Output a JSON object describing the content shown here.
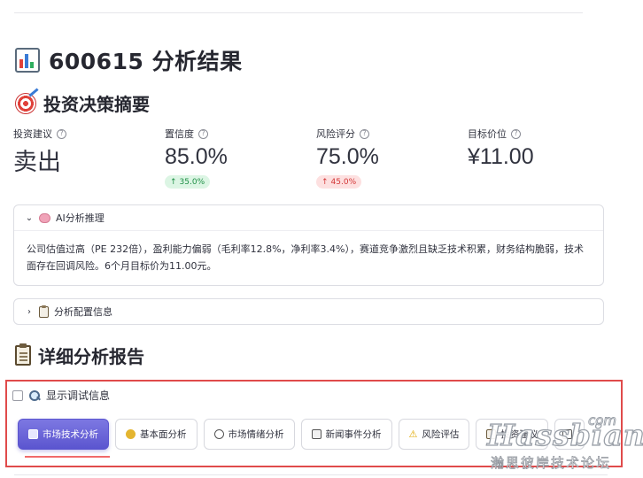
{
  "result_heading": {
    "text": "600615 分析结果",
    "icon": "bar-chart-icon"
  },
  "summary_heading": {
    "text": "投资决策摘要",
    "icon": "target-icon"
  },
  "metrics": [
    {
      "label": "投资建议",
      "value": "卖出",
      "delta": ""
    },
    {
      "label": "置信度",
      "value": "85.0%",
      "delta": "35.0%",
      "delta_direction": "up"
    },
    {
      "label": "风险评分",
      "value": "75.0%",
      "delta": "45.0%",
      "delta_direction": "up"
    },
    {
      "label": "目标价位",
      "value": "¥11.00",
      "delta": ""
    }
  ],
  "ai_reasoning": {
    "title": "AI分析推理",
    "expanded": true,
    "body": "公司估值过高（PE 232倍），盈利能力偏弱（毛利率12.8%，净利率3.4%），赛道竞争激烈且缺乏技术积累，财务结构脆弱，技术面存在回调风险。6个月目标价为11.00元。"
  },
  "config_info": {
    "title": "分析配置信息",
    "expanded": false
  },
  "report_heading": {
    "text": "详细分析报告",
    "icon": "clipboard-icon"
  },
  "debug_toggle": {
    "label": "显示调试信息",
    "checked": false
  },
  "tabs": [
    {
      "label": "市场技术分析",
      "icon": "chart-icon",
      "active": true
    },
    {
      "label": "基本面分析",
      "icon": "money-bag-icon",
      "active": false
    },
    {
      "label": "市场情绪分析",
      "icon": "speech-bubble-icon",
      "active": false
    },
    {
      "label": "新闻事件分析",
      "icon": "newspaper-icon",
      "active": false
    },
    {
      "label": "风险评估",
      "icon": "warning-icon",
      "active": false
    },
    {
      "label": "投资建议",
      "icon": "clipboard-icon",
      "active": false
    },
    {
      "label": "",
      "icon": "more-icon",
      "active": false
    }
  ],
  "watermark": {
    "brand": "Hassbian",
    "domain": "com",
    "subtitle": "瀚思彼岸技术论坛"
  },
  "colors": {
    "accent": "#5b55cf",
    "up": "#1f8f46",
    "down": "#d33636",
    "highlight_box": "#e04b4b"
  }
}
